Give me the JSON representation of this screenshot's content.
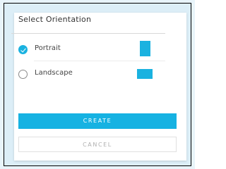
{
  "dialog": {
    "title": "Select Orientation",
    "options": [
      {
        "label": "Portrait",
        "selected": true,
        "icon": "portrait-page-icon"
      },
      {
        "label": "Landscape",
        "selected": false,
        "icon": "landscape-page-icon"
      }
    ],
    "create_label": "CREATE",
    "cancel_label": "CANCEL"
  },
  "colors": {
    "accent": "#1ab2e0",
    "background": "#dceef7"
  }
}
